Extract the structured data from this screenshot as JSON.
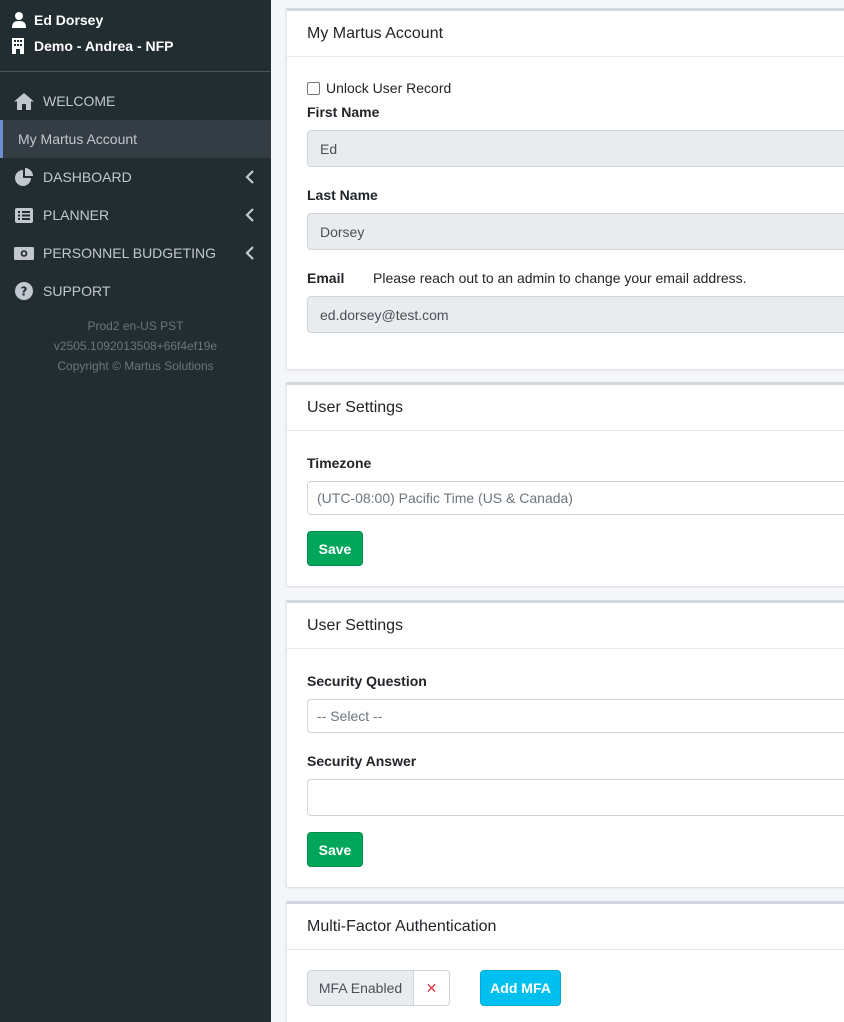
{
  "user": {
    "name": "Ed Dorsey",
    "organization": "Demo - Andrea - NFP"
  },
  "sidebar": {
    "items": [
      {
        "label": "WELCOME",
        "icon": "home-icon"
      },
      {
        "label": "My Martus Account",
        "icon": ""
      },
      {
        "label": "DASHBOARD",
        "icon": "pie-chart-icon"
      },
      {
        "label": "PLANNER",
        "icon": "list-icon"
      },
      {
        "label": "PERSONNEL BUDGETING",
        "icon": "money-icon"
      },
      {
        "label": "SUPPORT",
        "icon": "question-circle-icon"
      }
    ],
    "footer": {
      "env": "Prod2 en-US PST",
      "version": "v2505.1092013508+66f4ef19e",
      "copyright": "Copyright © Martus Solutions"
    }
  },
  "account_card": {
    "title": "My Martus Account",
    "unlock_label": "Unlock User Record",
    "unlock_checked": false,
    "first_name_label": "First Name",
    "first_name_value": "Ed",
    "last_name_label": "Last Name",
    "last_name_value": "Dorsey",
    "email_label": "Email",
    "email_note": "Please reach out to an admin to change your email address.",
    "email_value": "ed.dorsey@test.com"
  },
  "timezone_card": {
    "title": "User Settings",
    "timezone_label": "Timezone",
    "timezone_value": "(UTC-08:00) Pacific Time (US & Canada)",
    "save_label": "Save"
  },
  "security_card": {
    "title": "User Settings",
    "question_label": "Security Question",
    "question_value": "-- Select --",
    "answer_label": "Security Answer",
    "answer_value": "",
    "save_label": "Save"
  },
  "mfa_card": {
    "title": "Multi-Factor Authentication",
    "status_label": "MFA Enabled",
    "remove_glyph": "✕",
    "add_label": "Add MFA"
  },
  "colors": {
    "sidebar_bg": "#222d32",
    "active_accent": "#6e8cd0",
    "save_green": "#00a65a",
    "add_mfa_blue": "#00c0ef",
    "remove_red": "#dc3545"
  }
}
